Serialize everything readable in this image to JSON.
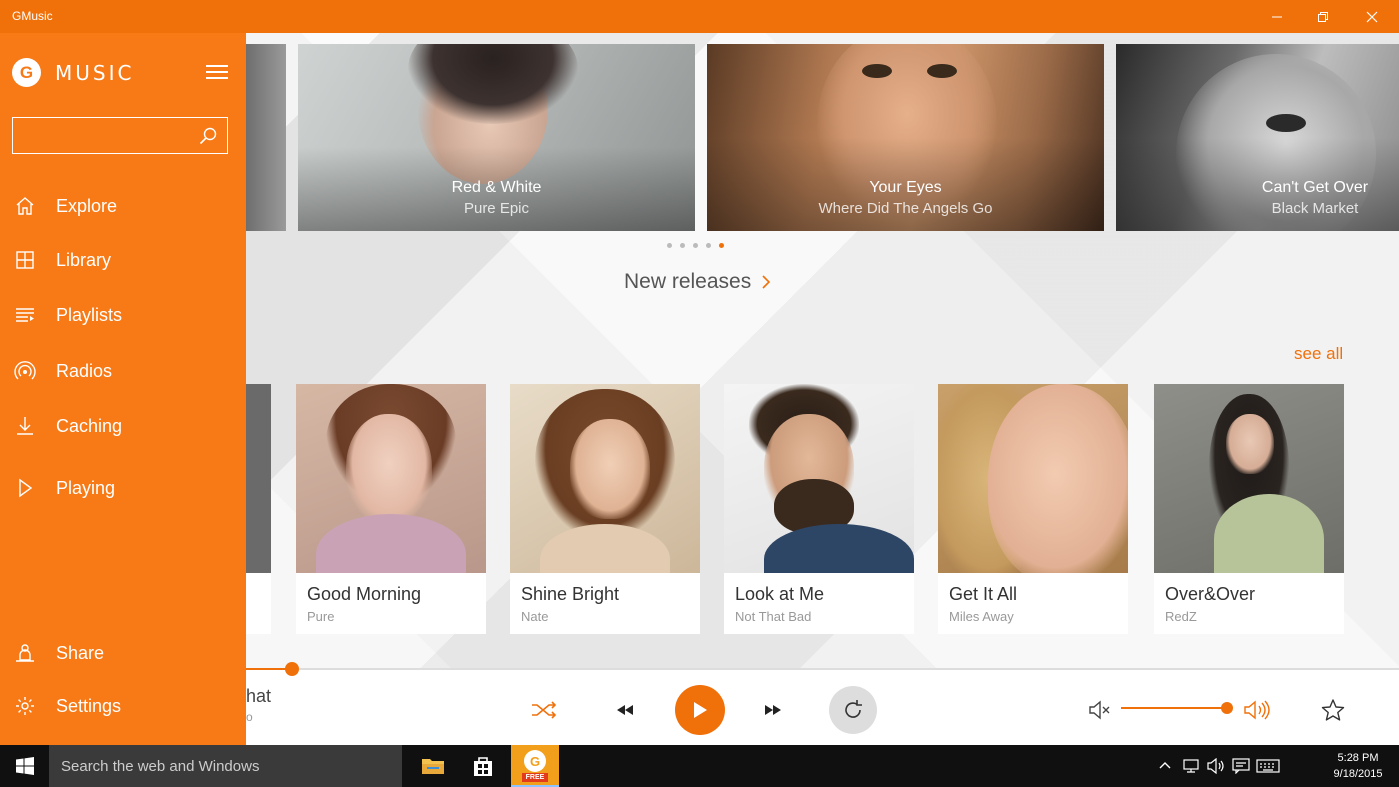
{
  "window": {
    "title": "GMusic"
  },
  "sidebar": {
    "logo_letter": "G",
    "logo_text": "MUSIC",
    "search_placeholder": "",
    "items": [
      {
        "label": "Explore",
        "icon": "home-icon"
      },
      {
        "label": "Library",
        "icon": "grid-icon"
      },
      {
        "label": "Playlists",
        "icon": "playlist-icon"
      },
      {
        "label": "Radios",
        "icon": "radio-icon"
      },
      {
        "label": "Caching",
        "icon": "download-icon"
      },
      {
        "label": "Playing",
        "icon": "play-outline-icon"
      },
      {
        "label": "Share",
        "icon": "share-icon"
      },
      {
        "label": "Settings",
        "icon": "gear-icon"
      }
    ]
  },
  "featured": [
    {
      "title": "Red & White",
      "subtitle": "Pure Epic"
    },
    {
      "title": "Your Eyes",
      "subtitle": "Where Did The Angels Go"
    },
    {
      "title": "Can't Get Over",
      "subtitle": "Black Market"
    }
  ],
  "carousel": {
    "pages": 5,
    "active_page": 5
  },
  "sections": {
    "new_releases_label": "New releases",
    "see_all_label": "see all"
  },
  "albums": [
    {
      "title": "Good Morning",
      "artist": "Pure"
    },
    {
      "title": "Shine Bright",
      "artist": "Nate"
    },
    {
      "title": "Look at Me",
      "artist": "Not That Bad"
    },
    {
      "title": "Get It All",
      "artist": "Miles Away"
    },
    {
      "title": "Over&Over",
      "artist": "RedZ"
    }
  ],
  "player": {
    "now_playing_title": "hat",
    "now_playing_sub": "o",
    "progress_fraction": 0.04,
    "volume_fraction": 1.0,
    "accent_color": "#f0700a"
  },
  "taskbar": {
    "search_placeholder": "Search the web and Windows",
    "time": "5:28 PM",
    "date": "9/18/2015",
    "gmusic_badge": "FREE"
  }
}
